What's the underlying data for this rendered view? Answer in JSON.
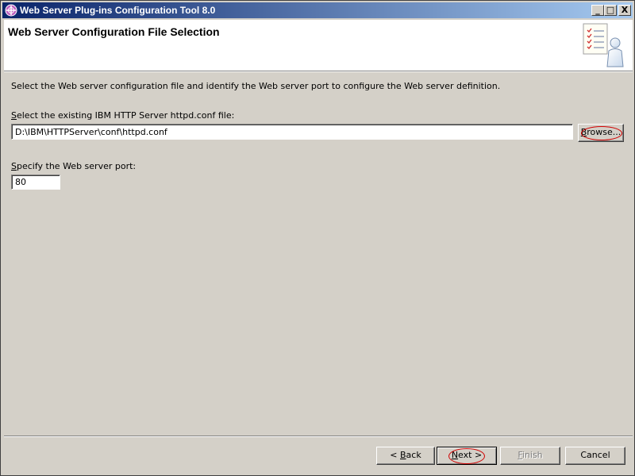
{
  "window": {
    "title": "Web Server Plug-ins Configuration Tool 8.0",
    "controls": {
      "minimize": "_",
      "maximize": "□",
      "close": "X"
    }
  },
  "header": {
    "title": "Web Server Configuration File Selection",
    "graphic_icon": "wizard-document-person-icon"
  },
  "body": {
    "description": "Select the Web server configuration file and identify the Web server port to configure the Web server definition.",
    "config_file_label_mnemonic": "S",
    "config_file_label_rest": "elect the existing IBM HTTP Server httpd.conf file:",
    "config_file_value": "D:\\IBM\\HTTPServer\\conf\\httpd.conf",
    "browse_mnemonic": "B",
    "browse_rest": "rowse...",
    "port_label_mnemonic": "S",
    "port_label_rest": "pecify the Web server port:",
    "port_value": "80"
  },
  "footer": {
    "back_prefix": "< ",
    "back_mnemonic": "B",
    "back_rest": "ack",
    "next_mnemonic": "N",
    "next_rest": "ext >",
    "finish_mnemonic": "F",
    "finish_rest": "inish",
    "cancel_label": "Cancel"
  },
  "colors": {
    "titlebar_start": "#0a246a",
    "titlebar_end": "#a6caf0",
    "dialog_bg": "#d4d0c8",
    "highlight_ring": "#d00000"
  }
}
